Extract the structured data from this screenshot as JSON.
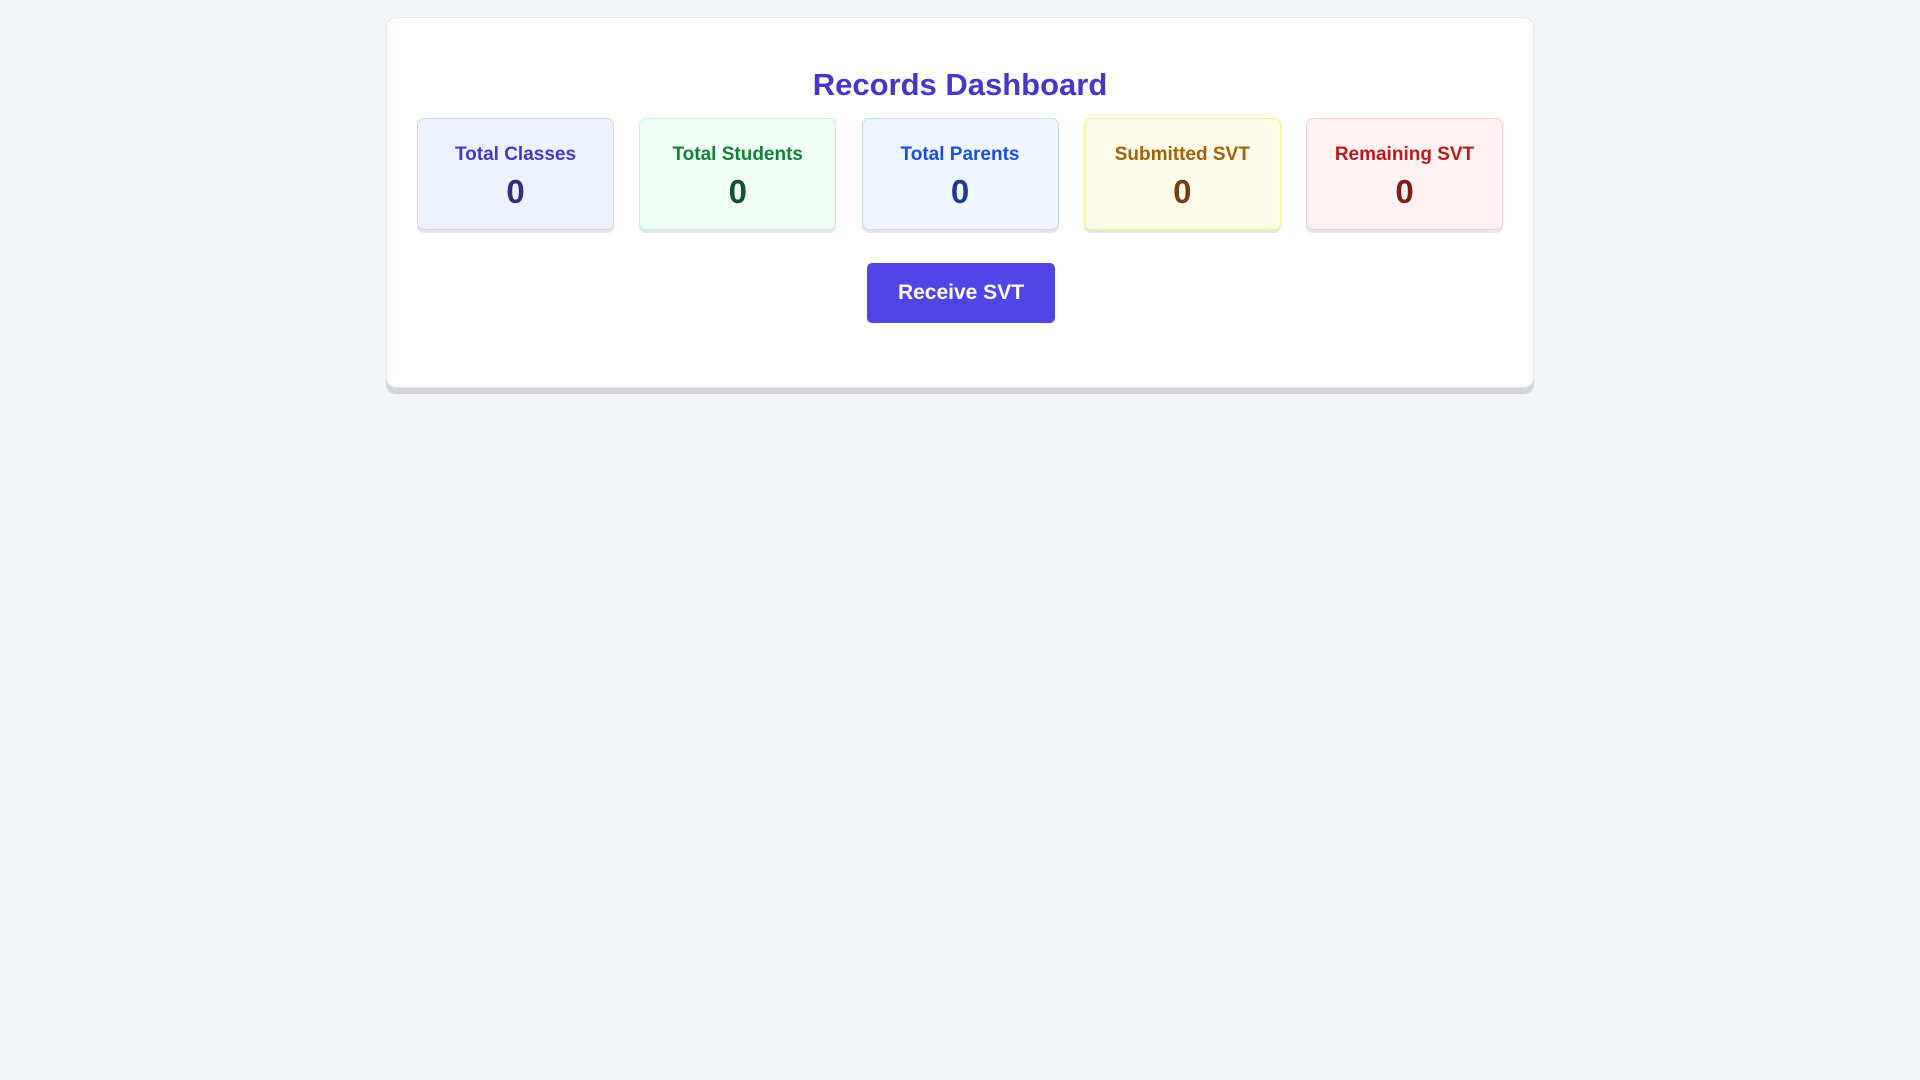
{
  "dashboard": {
    "title": "Records Dashboard",
    "stats": [
      {
        "label": "Total Classes",
        "value": "0",
        "color": "#4338ca"
      },
      {
        "label": "Total Students",
        "value": "0",
        "color": "#15803d"
      },
      {
        "label": "Total Parents",
        "value": "0",
        "color": "#1d4ed8"
      },
      {
        "label": "Submitted SVT",
        "value": "0",
        "color": "#a16207"
      },
      {
        "label": "Remaining SVT",
        "value": "0",
        "color": "#b91c1c"
      }
    ],
    "action_button_label": "Receive SVT",
    "accent_color": "#4f46e5",
    "background_color": "#f3f4f6"
  }
}
